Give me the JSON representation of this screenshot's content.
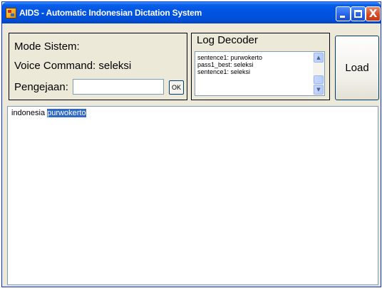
{
  "window": {
    "title": "AIDS - Automatic Indonesian Dictation System",
    "controls": {
      "minimize": "minimize-icon",
      "maximize": "maximize-icon",
      "close": "close-icon"
    },
    "close_glyph": "X"
  },
  "mode_panel": {
    "mode_label": "Mode Sistem:",
    "voice_command_label": "Voice Command: seleksi",
    "pengejaan_label": "Pengejaan:",
    "pengejaan_value": "",
    "ok_label": "OK"
  },
  "log_panel": {
    "title": "Log Decoder",
    "lines": [
      "sentence1: purwokerto",
      "pass1_best: seleksi",
      "sentence1: seleksi"
    ],
    "scroll_up_glyph": "▲",
    "scroll_down_glyph": "▼"
  },
  "load_button": {
    "label": "Load"
  },
  "editor": {
    "text_before": "indonesia ",
    "selected_text": "purwokerto"
  },
  "colors": {
    "titlebar": "#0054e3",
    "selection": "#316ac5",
    "window_bg": "#ece9d8"
  }
}
